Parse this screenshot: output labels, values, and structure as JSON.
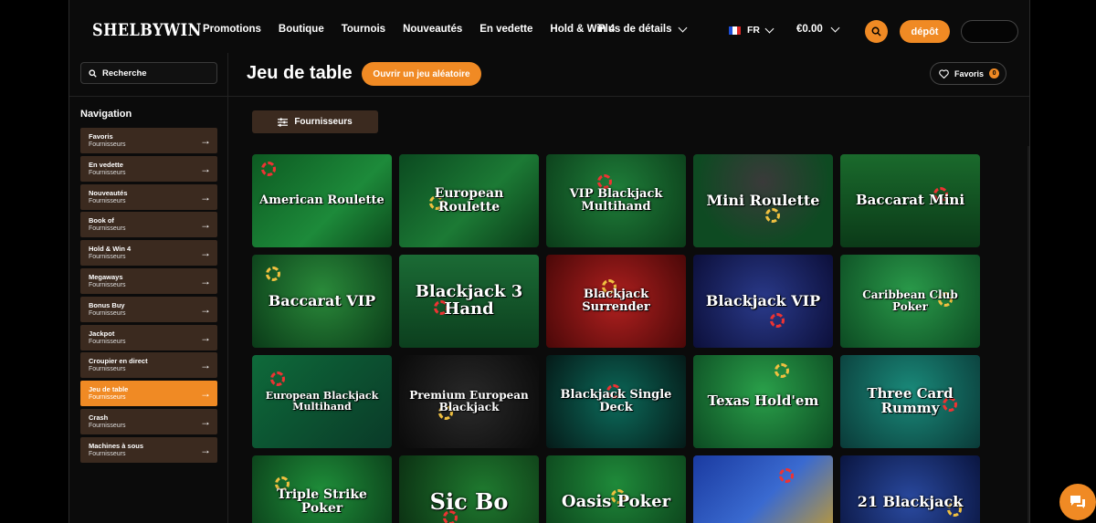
{
  "brand": {
    "logo": "SHELBYWIN",
    "accent": "#f08a24"
  },
  "nav": {
    "items": [
      "Promotions",
      "Boutique",
      "Tournois",
      "Nouveautés",
      "En vedette",
      "Hold & Win 4"
    ],
    "more_label": "Plus de détails"
  },
  "header": {
    "language": "FR",
    "balance": "€0.00",
    "deposit_label": "dépôt"
  },
  "sidebar": {
    "search_placeholder": "Recherche",
    "title": "Navigation",
    "items": [
      {
        "label": "Favoris",
        "sub": "Fournisseurs",
        "active": false
      },
      {
        "label": "En vedette",
        "sub": "Fournisseurs",
        "active": false
      },
      {
        "label": "Nouveautés",
        "sub": "Fournisseurs",
        "active": false
      },
      {
        "label": "Book of",
        "sub": "Fournisseurs",
        "active": false
      },
      {
        "label": "Hold & Win 4",
        "sub": "Fournisseurs",
        "active": false
      },
      {
        "label": "Megaways",
        "sub": "Fournisseurs",
        "active": false
      },
      {
        "label": "Bonus Buy",
        "sub": "Fournisseurs",
        "active": false
      },
      {
        "label": "Jackpot",
        "sub": "Fournisseurs",
        "active": false
      },
      {
        "label": "Croupier en direct",
        "sub": "Fournisseurs",
        "active": false
      },
      {
        "label": "Jeu de table",
        "sub": "Fournisseurs",
        "active": true
      },
      {
        "label": "Crash",
        "sub": "Fournisseurs",
        "active": false
      },
      {
        "label": "Machines à sous",
        "sub": "Fournisseurs",
        "active": false
      }
    ]
  },
  "main": {
    "title": "Jeu de table",
    "random_label": "Ouvrir un jeu aléatoire",
    "favorites_label": "Favoris",
    "favorites_count": "0",
    "providers_label": "Fournisseurs"
  },
  "games": [
    {
      "title": "American Roulette",
      "bg": "linear-gradient(135deg,#0d5a22,#1d8a3a 60%,#0c4a1c)",
      "size": "13px"
    },
    {
      "title": "European Roulette",
      "bg": "linear-gradient(135deg,#0b4a20,#1c7a35 55%,#0a3a18)",
      "size": "14px"
    },
    {
      "title": "VIP Blackjack Multihand",
      "bg": "radial-gradient(circle at 50% 40%,#1f7f3a,#0b3b19)",
      "size": "13px"
    },
    {
      "title": "Mini Roulette",
      "bg": "radial-gradient(circle at 50% 30%,#3a3a3a,#0e4a22 70%)",
      "size": "16px"
    },
    {
      "title": "Baccarat Mini",
      "bg": "linear-gradient(180deg,#1a6a2c,#0b3a18)",
      "size": "15px"
    },
    {
      "title": "Baccarat VIP",
      "bg": "radial-gradient(circle at 50% 40%,#2a8a3a,#0a3a18)",
      "size": "16px"
    },
    {
      "title": "Blackjack 3 Hand",
      "bg": "linear-gradient(180deg,#1b6b35,#0c3f1e)",
      "size": "18px"
    },
    {
      "title": "Blackjack Surrender",
      "bg": "radial-gradient(circle at 50% 50%,#b0201f,#4a0808)",
      "size": "13px"
    },
    {
      "title": "Blackjack VIP",
      "bg": "radial-gradient(circle at 50% 50%,#2a3a8a,#0c0f3a)",
      "size": "16px"
    },
    {
      "title": "Caribbean Club Poker",
      "bg": "radial-gradient(circle at 50% 40%,#2a9a4a,#0c4a22)",
      "size": "12px"
    },
    {
      "title": "European Blackjack Multihand",
      "bg": "linear-gradient(135deg,#0e6a3a,#0a3a28)",
      "size": "11px"
    },
    {
      "title": "Premium European Blackjack",
      "bg": "radial-gradient(circle at 50% 50%,#2a2a2a,#0a0a0a)",
      "size": "12px"
    },
    {
      "title": "Blackjack Single Deck",
      "bg": "radial-gradient(circle at 50% 50%,#0c6a5a,#051a18)",
      "size": "13px"
    },
    {
      "title": "Texas Hold'em",
      "bg": "radial-gradient(circle at 50% 40%,#2aa04a,#0c4a22)",
      "size": "15px"
    },
    {
      "title": "Three Card Rummy",
      "bg": "radial-gradient(circle at 50% 40%,#1a8a7a,#0a3a38)",
      "size": "15px"
    },
    {
      "title": "Triple Strike Poker",
      "bg": "radial-gradient(circle at 50% 40%,#1f8f3a,#0a3a18)",
      "size": "14px"
    },
    {
      "title": "Sic Bo",
      "bg": "radial-gradient(circle at 60% 40%,#1f7a2f,#0a2a10)",
      "size": "24px"
    },
    {
      "title": "Oasis Poker",
      "bg": "radial-gradient(circle at 50% 30%,#1f8a3a,#0a3a18)",
      "size": "18px"
    },
    {
      "title": "",
      "bg": "linear-gradient(135deg,#1a3aa0,#3a6ad0 50%,#d0a020)",
      "size": "14px"
    },
    {
      "title": "21 Blackjack",
      "bg": "radial-gradient(circle at 50% 50%,#2a4aa0,#0a1540)",
      "size": "16px"
    }
  ],
  "icons": {
    "search": "search-icon",
    "chevron": "chevron-down-icon",
    "arrow": "arrow-right-icon",
    "heart": "heart-icon",
    "filter": "sliders-icon",
    "chat": "chat-icon"
  }
}
